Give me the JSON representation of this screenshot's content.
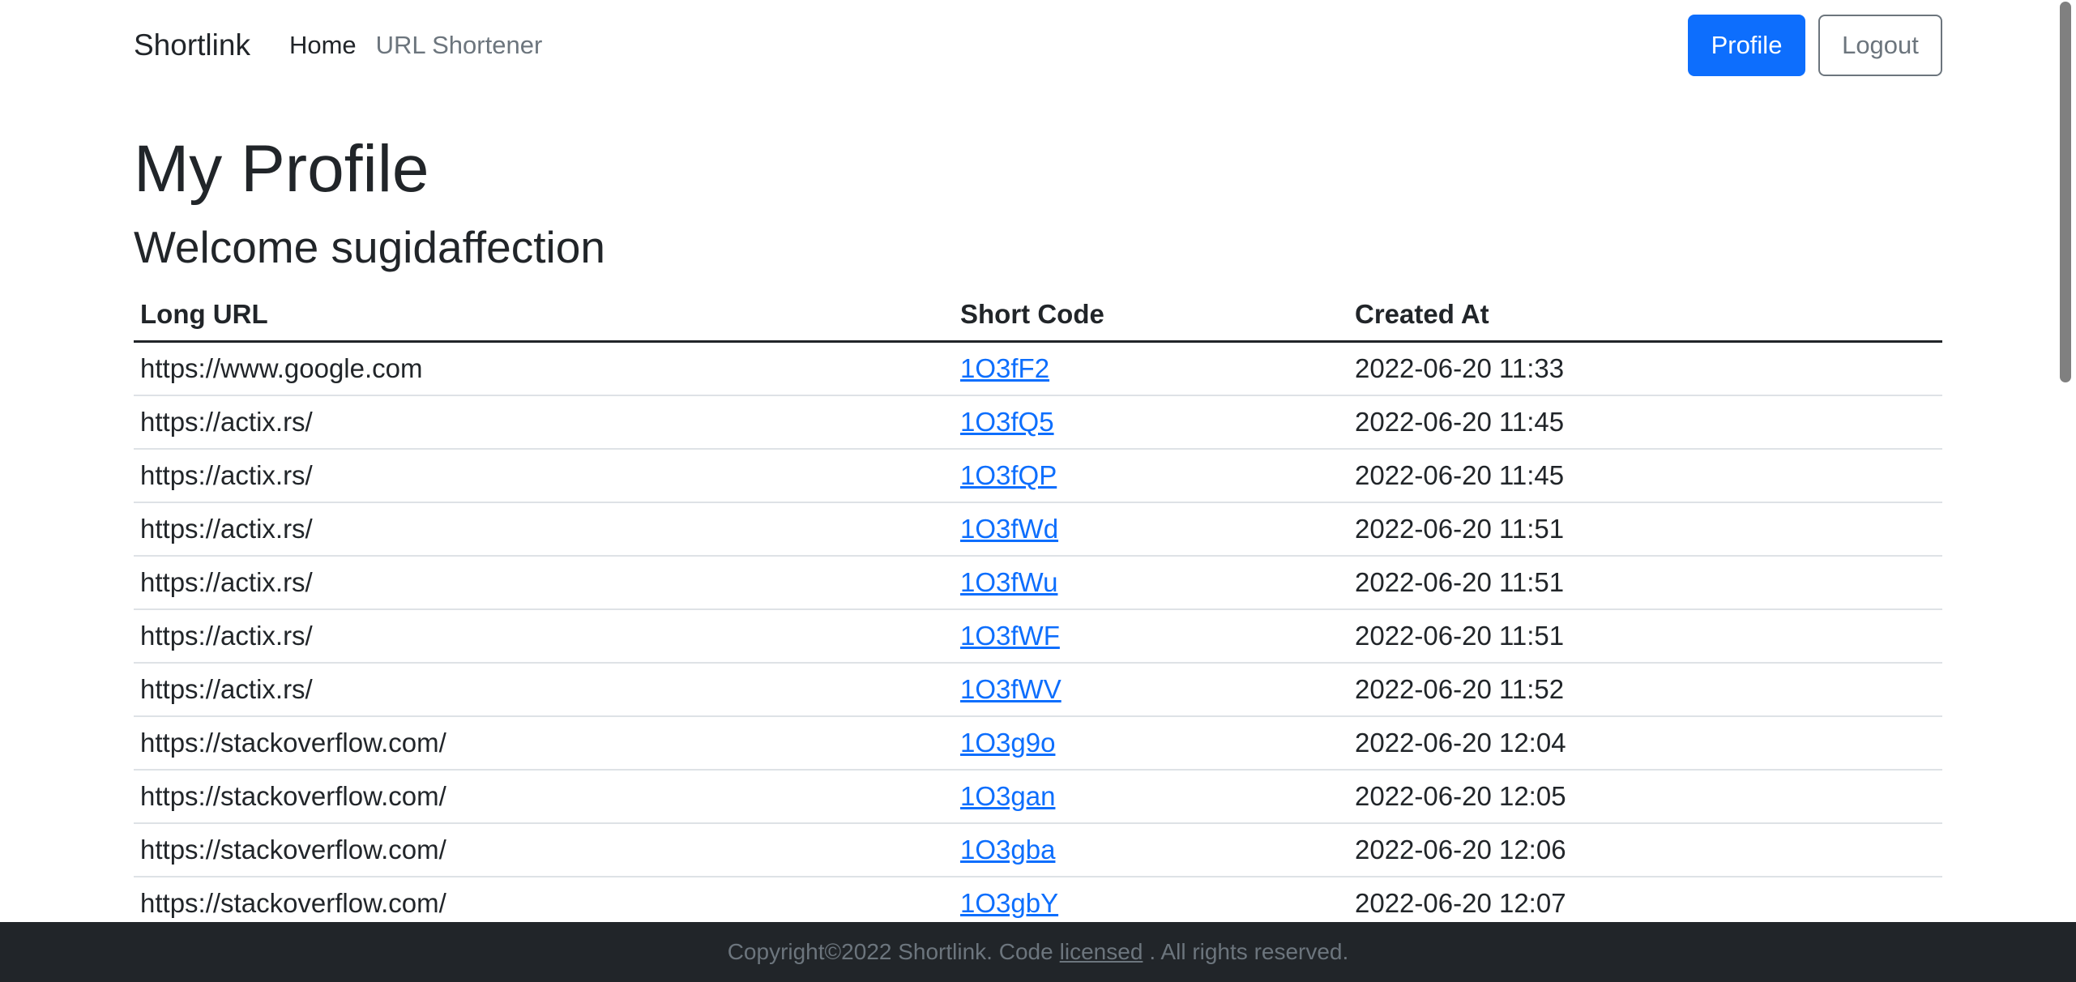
{
  "navbar": {
    "brand": "Shortlink",
    "links": [
      {
        "label": "Home",
        "active": true
      },
      {
        "label": "URL Shortener",
        "active": false
      }
    ],
    "profile_button": "Profile",
    "logout_button": "Logout"
  },
  "page": {
    "title": "My Profile",
    "welcome": "Welcome sugidaffection"
  },
  "table": {
    "headers": [
      "Long URL",
      "Short Code",
      "Created At"
    ],
    "rows": [
      {
        "long_url": "https://www.google.com",
        "short_code": "1O3fF2",
        "created_at": "2022-06-20 11:33"
      },
      {
        "long_url": "https://actix.rs/",
        "short_code": "1O3fQ5",
        "created_at": "2022-06-20 11:45"
      },
      {
        "long_url": "https://actix.rs/",
        "short_code": "1O3fQP",
        "created_at": "2022-06-20 11:45"
      },
      {
        "long_url": "https://actix.rs/",
        "short_code": "1O3fWd",
        "created_at": "2022-06-20 11:51"
      },
      {
        "long_url": "https://actix.rs/",
        "short_code": "1O3fWu",
        "created_at": "2022-06-20 11:51"
      },
      {
        "long_url": "https://actix.rs/",
        "short_code": "1O3fWF",
        "created_at": "2022-06-20 11:51"
      },
      {
        "long_url": "https://actix.rs/",
        "short_code": "1O3fWV",
        "created_at": "2022-06-20 11:52"
      },
      {
        "long_url": "https://stackoverflow.com/",
        "short_code": "1O3g9o",
        "created_at": "2022-06-20 12:04"
      },
      {
        "long_url": "https://stackoverflow.com/",
        "short_code": "1O3gan",
        "created_at": "2022-06-20 12:05"
      },
      {
        "long_url": "https://stackoverflow.com/",
        "short_code": "1O3gba",
        "created_at": "2022-06-20 12:06"
      },
      {
        "long_url": "https://stackoverflow.com/",
        "short_code": "1O3gbY",
        "created_at": "2022-06-20 12:07"
      }
    ]
  },
  "footer": {
    "prefix": "Copyright©2022 Shortlink. Code",
    "link": "licensed",
    "suffix": ". All rights reserved."
  },
  "colors": {
    "primary": "#0d6efd",
    "text": "#212529",
    "muted": "#6c757d",
    "footer_bg": "#212529",
    "row_border": "#dee2e6"
  }
}
